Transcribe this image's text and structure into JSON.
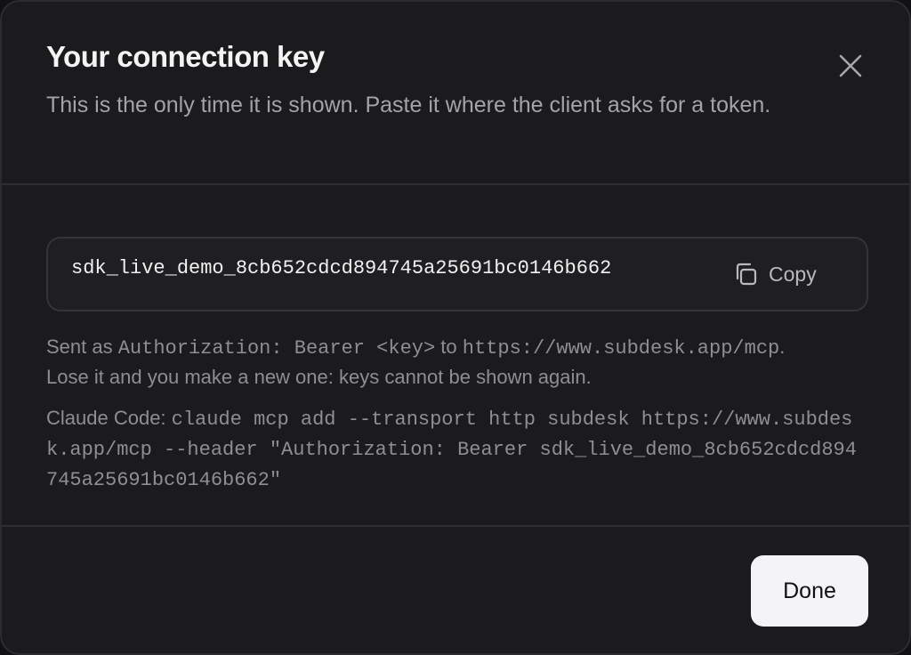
{
  "dialog": {
    "title": "Your connection key",
    "subtitle": "This is the only time it is shown. Paste it where the client asks for a token."
  },
  "key": {
    "value": "sdk_live_demo_8cb652cdcd894745a25691bc0146b662",
    "copy_label": "Copy"
  },
  "note": {
    "prefix": "Sent as ",
    "header_code": "Authorization: Bearer <key>",
    "middle": " to ",
    "url_code": "https://www.subdesk.app/mcp",
    "suffix": ".",
    "warning": "Lose it and you make a new one: keys cannot be shown again."
  },
  "command": {
    "label": "Claude Code: ",
    "code": "claude mcp add --transport http subdesk https://www.subdesk.app/mcp --header \"Authorization: Bearer sdk_live_demo_8cb652cdcd894745a25691bc0146b662\""
  },
  "footer": {
    "done_label": "Done"
  },
  "icons": {
    "close": "close-icon",
    "copy": "copy-icon"
  }
}
